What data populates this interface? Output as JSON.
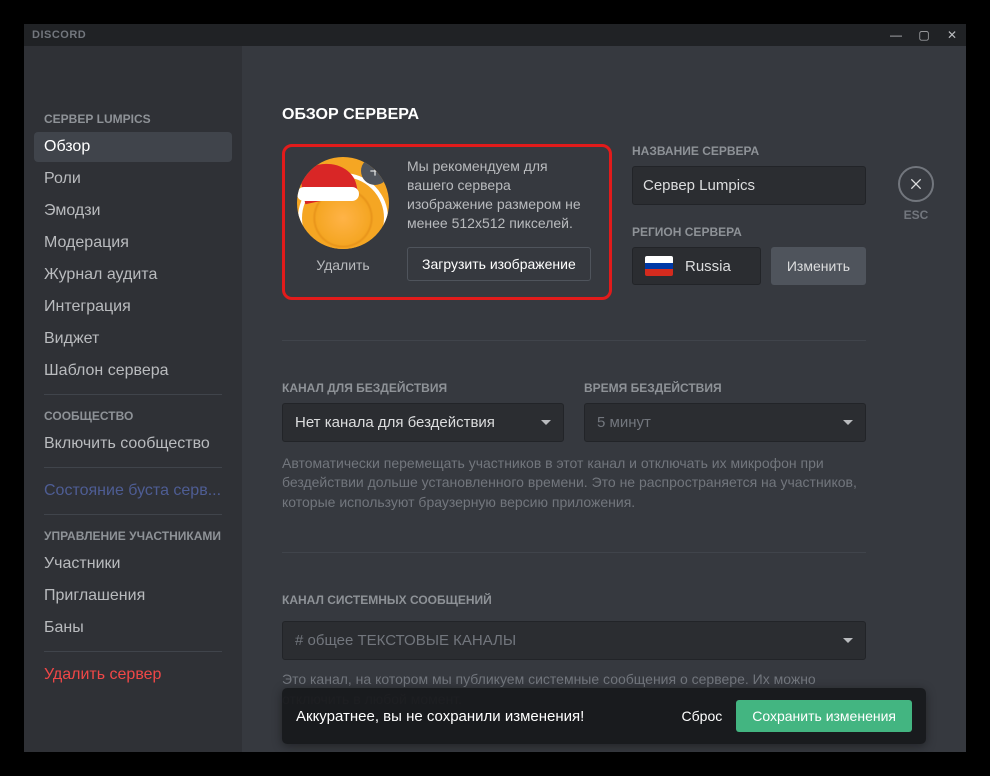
{
  "titlebar": {
    "app_name": "DISCORD"
  },
  "close": {
    "label": "ESC"
  },
  "sidebar": {
    "sections": [
      {
        "header": "СЕРВЕР LUMPICS",
        "items": [
          "Обзор",
          "Роли",
          "Эмодзи",
          "Модерация",
          "Журнал аудита",
          "Интеграция",
          "Виджет",
          "Шаблон сервера"
        ]
      },
      {
        "header": "СООБЩЕСТВО",
        "items": [
          "Включить сообщество"
        ],
        "boost": "Состояние буста серв..."
      },
      {
        "header": "УПРАВЛЕНИЕ УЧАСТНИКАМИ",
        "items": [
          "Участники",
          "Приглашения",
          "Баны"
        ]
      }
    ],
    "delete_server": "Удалить сервер"
  },
  "content": {
    "title": "ОБЗОР СЕРВЕРА",
    "recommend": "Мы рекомендуем для вашего сервера изображение размером не менее 512х512 пикселей.",
    "upload_btn": "Загрузить изображение",
    "delete_avatar": "Удалить",
    "server_name_label": "НАЗВАНИЕ СЕРВЕРА",
    "server_name_value": "Сервер Lumpics",
    "region_label": "РЕГИОН СЕРВЕРА",
    "region_value": "Russia",
    "region_change": "Изменить",
    "afk_channel_label": "КАНАЛ ДЛЯ БЕЗДЕЙСТВИЯ",
    "afk_channel_value": "Нет канала для бездействия",
    "afk_timeout_label": "ВРЕМЯ БЕЗДЕЙСТВИЯ",
    "afk_timeout_value": "5 минут",
    "afk_help": "Автоматически перемещать участников в этот канал и отключать их микрофон при бездействии дольше установленного времени. Это не распространяется на участников, которые используют браузерную версию приложения.",
    "sys_label": "КАНАЛ СИСТЕМНЫХ СООБЩЕНИЙ",
    "sys_value": "# общее ТЕКСТОВЫЕ КАНАЛЫ",
    "sys_help": "Это канал, на котором мы публикуем системные сообщения о сервере. Их можно отключить в любой момент."
  },
  "toast": {
    "message": "Аккуратнее, вы не сохранили изменения!",
    "reset": "Сброс",
    "save": "Сохранить изменения"
  }
}
